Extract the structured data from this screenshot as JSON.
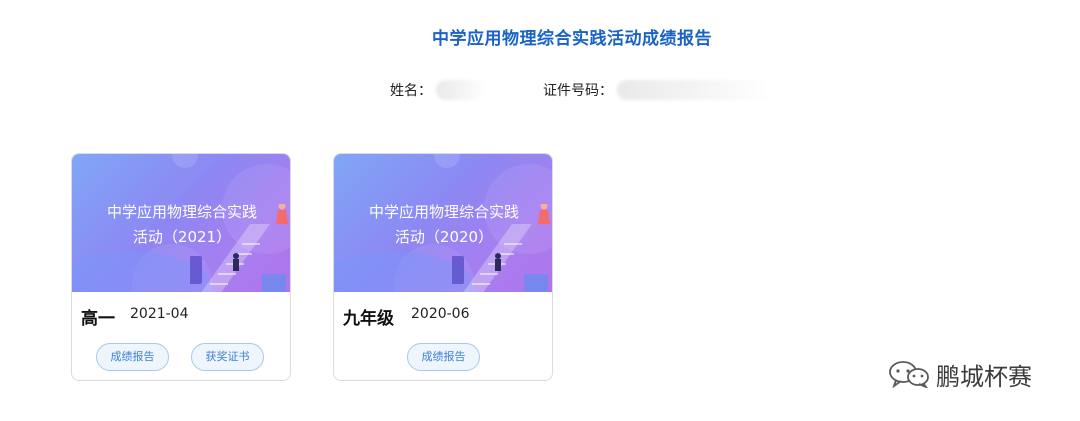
{
  "report": {
    "title": "中学应用物理综合实践活动成绩报告",
    "name_label": "姓名：",
    "id_label": "证件号码："
  },
  "cards": [
    {
      "banner_line1": "中学应用物理综合实践",
      "banner_line2": "活动（2021）",
      "grade": "高一",
      "date": "2021-04",
      "buttons": [
        "成绩报告",
        "获奖证书"
      ]
    },
    {
      "banner_line1": "中学应用物理综合实践",
      "banner_line2": "活动（2020）",
      "grade": "九年级",
      "date": "2020-06",
      "buttons": [
        "成绩报告"
      ]
    }
  ],
  "watermark": {
    "text": "鹏城杯赛",
    "icon": "wechat-icon"
  },
  "colors": {
    "title": "#1a63c6",
    "pill_border": "#a8c8ef",
    "pill_text": "#3d7fd6",
    "banner_start": "#7fa7f6",
    "banner_end": "#b174ea"
  }
}
